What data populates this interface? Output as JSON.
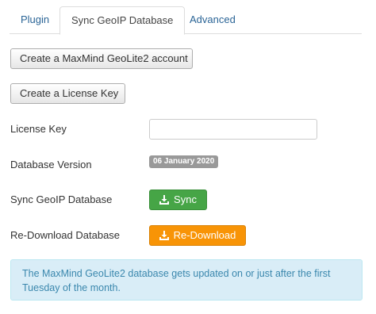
{
  "tabs": [
    {
      "label": "Plugin",
      "active": false
    },
    {
      "label": "Sync GeoIP Database",
      "active": true
    },
    {
      "label": "Advanced",
      "active": false
    }
  ],
  "buttons": {
    "maxmind_account": "Create a MaxMind GeoLite2 account",
    "license_key": "Create a License Key",
    "sync": "Sync",
    "redownload": "Re-Download"
  },
  "form": {
    "license_key_label": "License Key",
    "license_key_value": "",
    "database_version_label": "Database Version",
    "database_version_value": "06 January 2020",
    "sync_label": "Sync GeoIP Database",
    "redownload_label": "Re-Download Database"
  },
  "alert": {
    "text": "The MaxMind GeoLite2 database gets updated on or just after the first Tuesday of the month."
  },
  "icons": {
    "sync_icon": "download-icon",
    "redownload_icon": "download-icon"
  },
  "colors": {
    "link": "#2a6496",
    "success": "#46a546",
    "warning": "#f89406",
    "badge": "#999999",
    "info_bg": "#d9edf7",
    "info_text": "#3a87ad"
  }
}
